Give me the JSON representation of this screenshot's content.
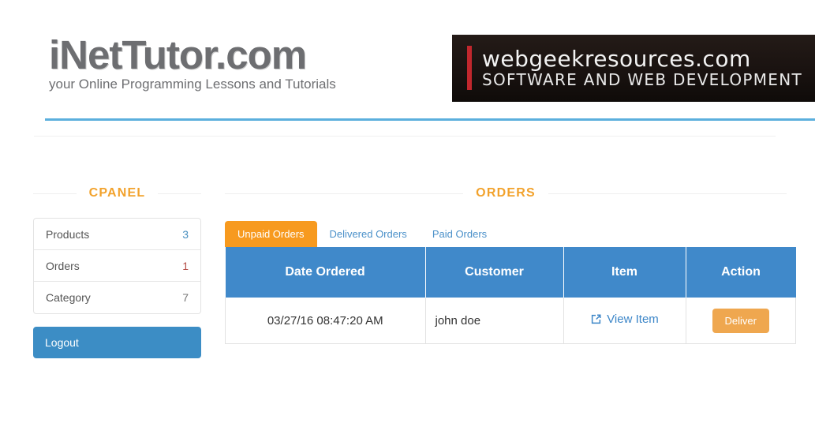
{
  "header": {
    "logo_title": "iNetTutor.com",
    "logo_tagline": "your Online Programming Lessons and Tutorials",
    "banner_line1": "webgeekresources.com",
    "banner_line2": "SOFTWARE AND WEB DEVELOPMENT"
  },
  "cpanel": {
    "title": "CPANEL",
    "items": [
      {
        "label": "Products",
        "count": "3",
        "color": "#4a90c0"
      },
      {
        "label": "Orders",
        "count": "1",
        "color": "#b5504a"
      },
      {
        "label": "Category",
        "count": "7",
        "color": "#777777"
      }
    ],
    "logout_label": "Logout"
  },
  "orders": {
    "title": "ORDERS",
    "tabs": [
      {
        "label": "Unpaid Orders",
        "active": true
      },
      {
        "label": "Delivered Orders",
        "active": false
      },
      {
        "label": "Paid Orders",
        "active": false
      }
    ],
    "columns": [
      "Date Ordered",
      "Customer",
      "Item",
      "Action"
    ],
    "rows": [
      {
        "date": "03/27/16 08:47:20 AM",
        "customer": "john doe",
        "item_link": "View Item",
        "action_label": "Deliver"
      }
    ]
  },
  "colors": {
    "accent_orange": "#f2a22c",
    "tab_active": "#f79a1f",
    "table_header_blue": "#4089ca",
    "link_blue": "#3c86c8",
    "logout_blue": "#3c8dc5",
    "deliver_orange": "#efa74f",
    "rule_blue": "#5bafdd",
    "banner_bg": "#1d1613",
    "banner_bar_red": "#c1272d"
  }
}
